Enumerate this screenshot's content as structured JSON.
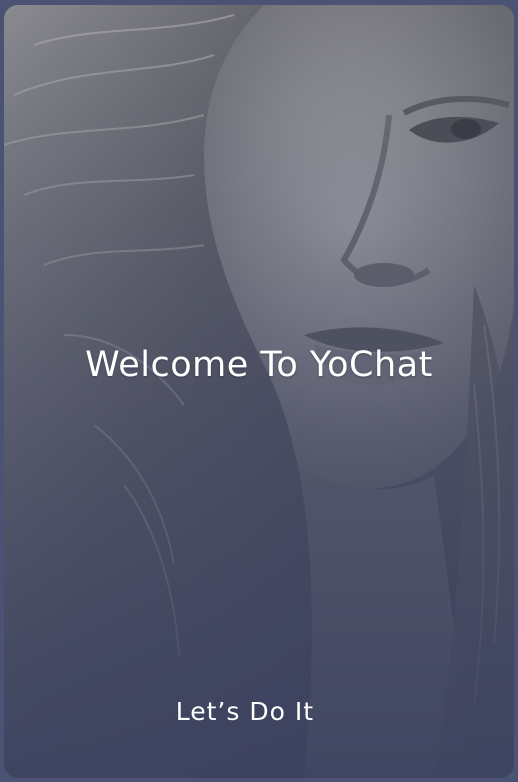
{
  "welcome_screen": {
    "title": "Welcome To YoChat",
    "cta_label": "Let’s Do It"
  },
  "colors": {
    "frame_background": "#4b5375",
    "overlay_bottom": "#3f4561",
    "text": "#ffffff"
  },
  "background_image": {
    "description_icon": "portrait-photo"
  }
}
